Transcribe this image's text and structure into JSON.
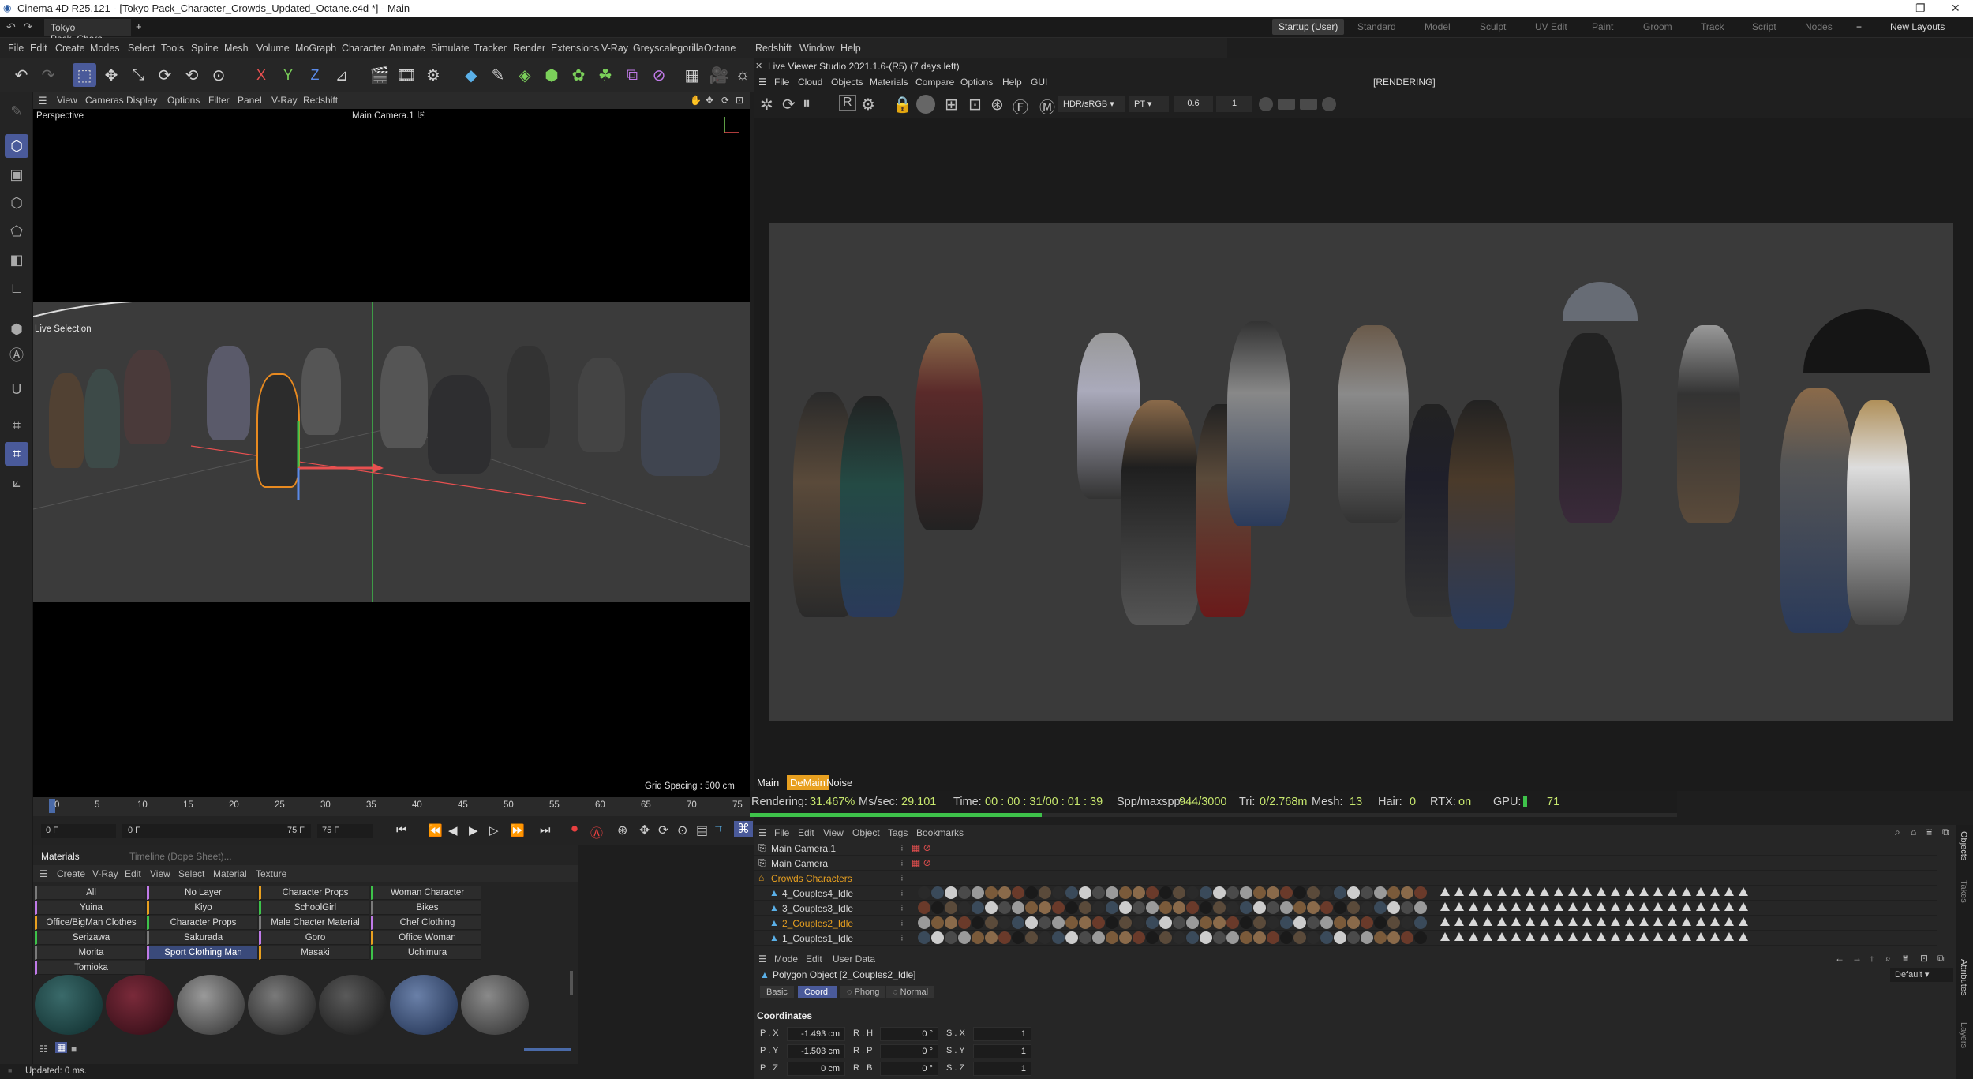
{
  "titlebar": {
    "title": "Cinema 4D R25.121 - [Tokyo Pack_Character_Crowds_Updated_Octane.c4d *] - Main",
    "minimize": "—",
    "maximize": "❐",
    "close": "✕"
  },
  "tabs": {
    "doc": "Tokyo Pack_Chara...",
    "close": "✕",
    "add": "+",
    "layouts": [
      "Startup (User)",
      "Standard",
      "Model",
      "Sculpt",
      "UV Edit",
      "Paint",
      "Groom",
      "Track",
      "Script",
      "Nodes"
    ],
    "new_layouts": "New Layouts"
  },
  "menu": [
    "File",
    "Edit",
    "Create",
    "Modes",
    "Select",
    "Tools",
    "Spline",
    "Mesh",
    "Volume",
    "MoGraph",
    "Character",
    "Animate",
    "Simulate",
    "Tracker",
    "Render",
    "Extensions",
    "V-Ray",
    "Greyscalegorilla",
    "Octane",
    "Redshift",
    "Window",
    "Help"
  ],
  "axes": {
    "x": "X",
    "y": "Y",
    "z": "Z"
  },
  "viewport": {
    "menu": [
      "View",
      "Cameras",
      "Display",
      "Options",
      "Filter",
      "Panel",
      "V-Ray",
      "Redshift"
    ],
    "name": "Perspective",
    "camera": "Main Camera.1",
    "tool": "Live Selection",
    "grid": "Grid Spacing : 500 cm"
  },
  "timeline": {
    "ticks": [
      "0",
      "5",
      "10",
      "15",
      "20",
      "25",
      "30",
      "35",
      "40",
      "45",
      "50",
      "55",
      "60",
      "65",
      "70",
      "75"
    ],
    "start": "0 F",
    "current": "0 F",
    "end": "75 F",
    "end2": "75 F"
  },
  "materials": {
    "tabs": [
      "Materials",
      "Timeline (Dope Sheet)..."
    ],
    "menu": [
      "Create",
      "V-Ray",
      "Edit",
      "View",
      "Select",
      "Material",
      "Texture"
    ],
    "grid": [
      [
        "All",
        "No Layer",
        "Character Props",
        "Woman Character Materials"
      ],
      [
        "Yuina",
        "Kiyo",
        "SchoolGirl",
        "Bikes"
      ],
      [
        "Office/BigMan Clothes",
        "Character Props",
        "Male Chacter Material",
        "Chef Clothing"
      ],
      [
        "Serizawa",
        "Sakurada",
        "Goro",
        "Office Woman"
      ],
      [
        "Morita",
        "Sport Clothing Man",
        "Masaki",
        "Uchimura"
      ],
      [
        "Tomioka",
        "",
        "",
        ""
      ]
    ],
    "selected": "Sport Clothing Man"
  },
  "lvs": {
    "title": "Live Viewer Studio 2021.1.6-(R5) (7 days left)",
    "menu": [
      "File",
      "Cloud",
      "Objects",
      "Materials",
      "Compare",
      "Options",
      "Help",
      "GUI"
    ],
    "status": "[RENDERING]",
    "colorspace": "HDR/sRGB",
    "kernel": "PT",
    "value": "0.6",
    "step": "1",
    "tabs": [
      "Main",
      "DeMain",
      "Noise"
    ],
    "render": {
      "label": "Rendering:",
      "pct": "31.467%",
      "ms": "Ms/sec:",
      "ms_v": "29.101",
      "time": "Time:",
      "time_v": "00 : 00 : 31/00 : 01 : 39",
      "spp": "Spp/maxspp:",
      "spp_v": "944/3000",
      "tri": "Tri:",
      "tri_v": "0/2.768m",
      "mesh": "Mesh:",
      "mesh_v": "13",
      "hair": "Hair:",
      "hair_v": "0",
      "rtx": "RTX:",
      "rtx_v": "on",
      "gpu": "GPU:",
      "gpu_v": "71",
      "progress": 0.31467
    }
  },
  "objects": {
    "menu": [
      "File",
      "Edit",
      "View",
      "Object",
      "Tags",
      "Bookmarks"
    ],
    "rows": [
      "Main Camera.1",
      "Main Camera",
      "Crowds Characters",
      "4_Couples4_Idle",
      "3_Couples3_Idle",
      "2_Couples2_Idle",
      "1_Couples1_Idle"
    ]
  },
  "attributes": {
    "menu": [
      "Mode",
      "Edit",
      "User Data"
    ],
    "object": "Polygon Object [2_Couples2_Idle]",
    "preset": "Default",
    "tabs": [
      "Basic",
      "Coord.",
      "Phong",
      "Normal"
    ],
    "section": "Coordinates",
    "fields": [
      [
        "P . X",
        "-1.493 cm",
        "R . H",
        "0 °",
        "S . X",
        "1"
      ],
      [
        "P . Y",
        "-1.503 cm",
        "R . P",
        "0 °",
        "S . Y",
        "1"
      ],
      [
        "P . Z",
        "0 cm",
        "R . B",
        "0 °",
        "S . Z",
        "1"
      ]
    ]
  },
  "right_tabs": [
    "Objects",
    "Takes",
    "Attributes",
    "Layers"
  ],
  "status": "Updated: 0 ms.",
  "colors": {
    "accent": "#4a6aa8",
    "progress": "#3ec24a",
    "orange": "#e8a020",
    "render_value": "#c8e86e"
  }
}
